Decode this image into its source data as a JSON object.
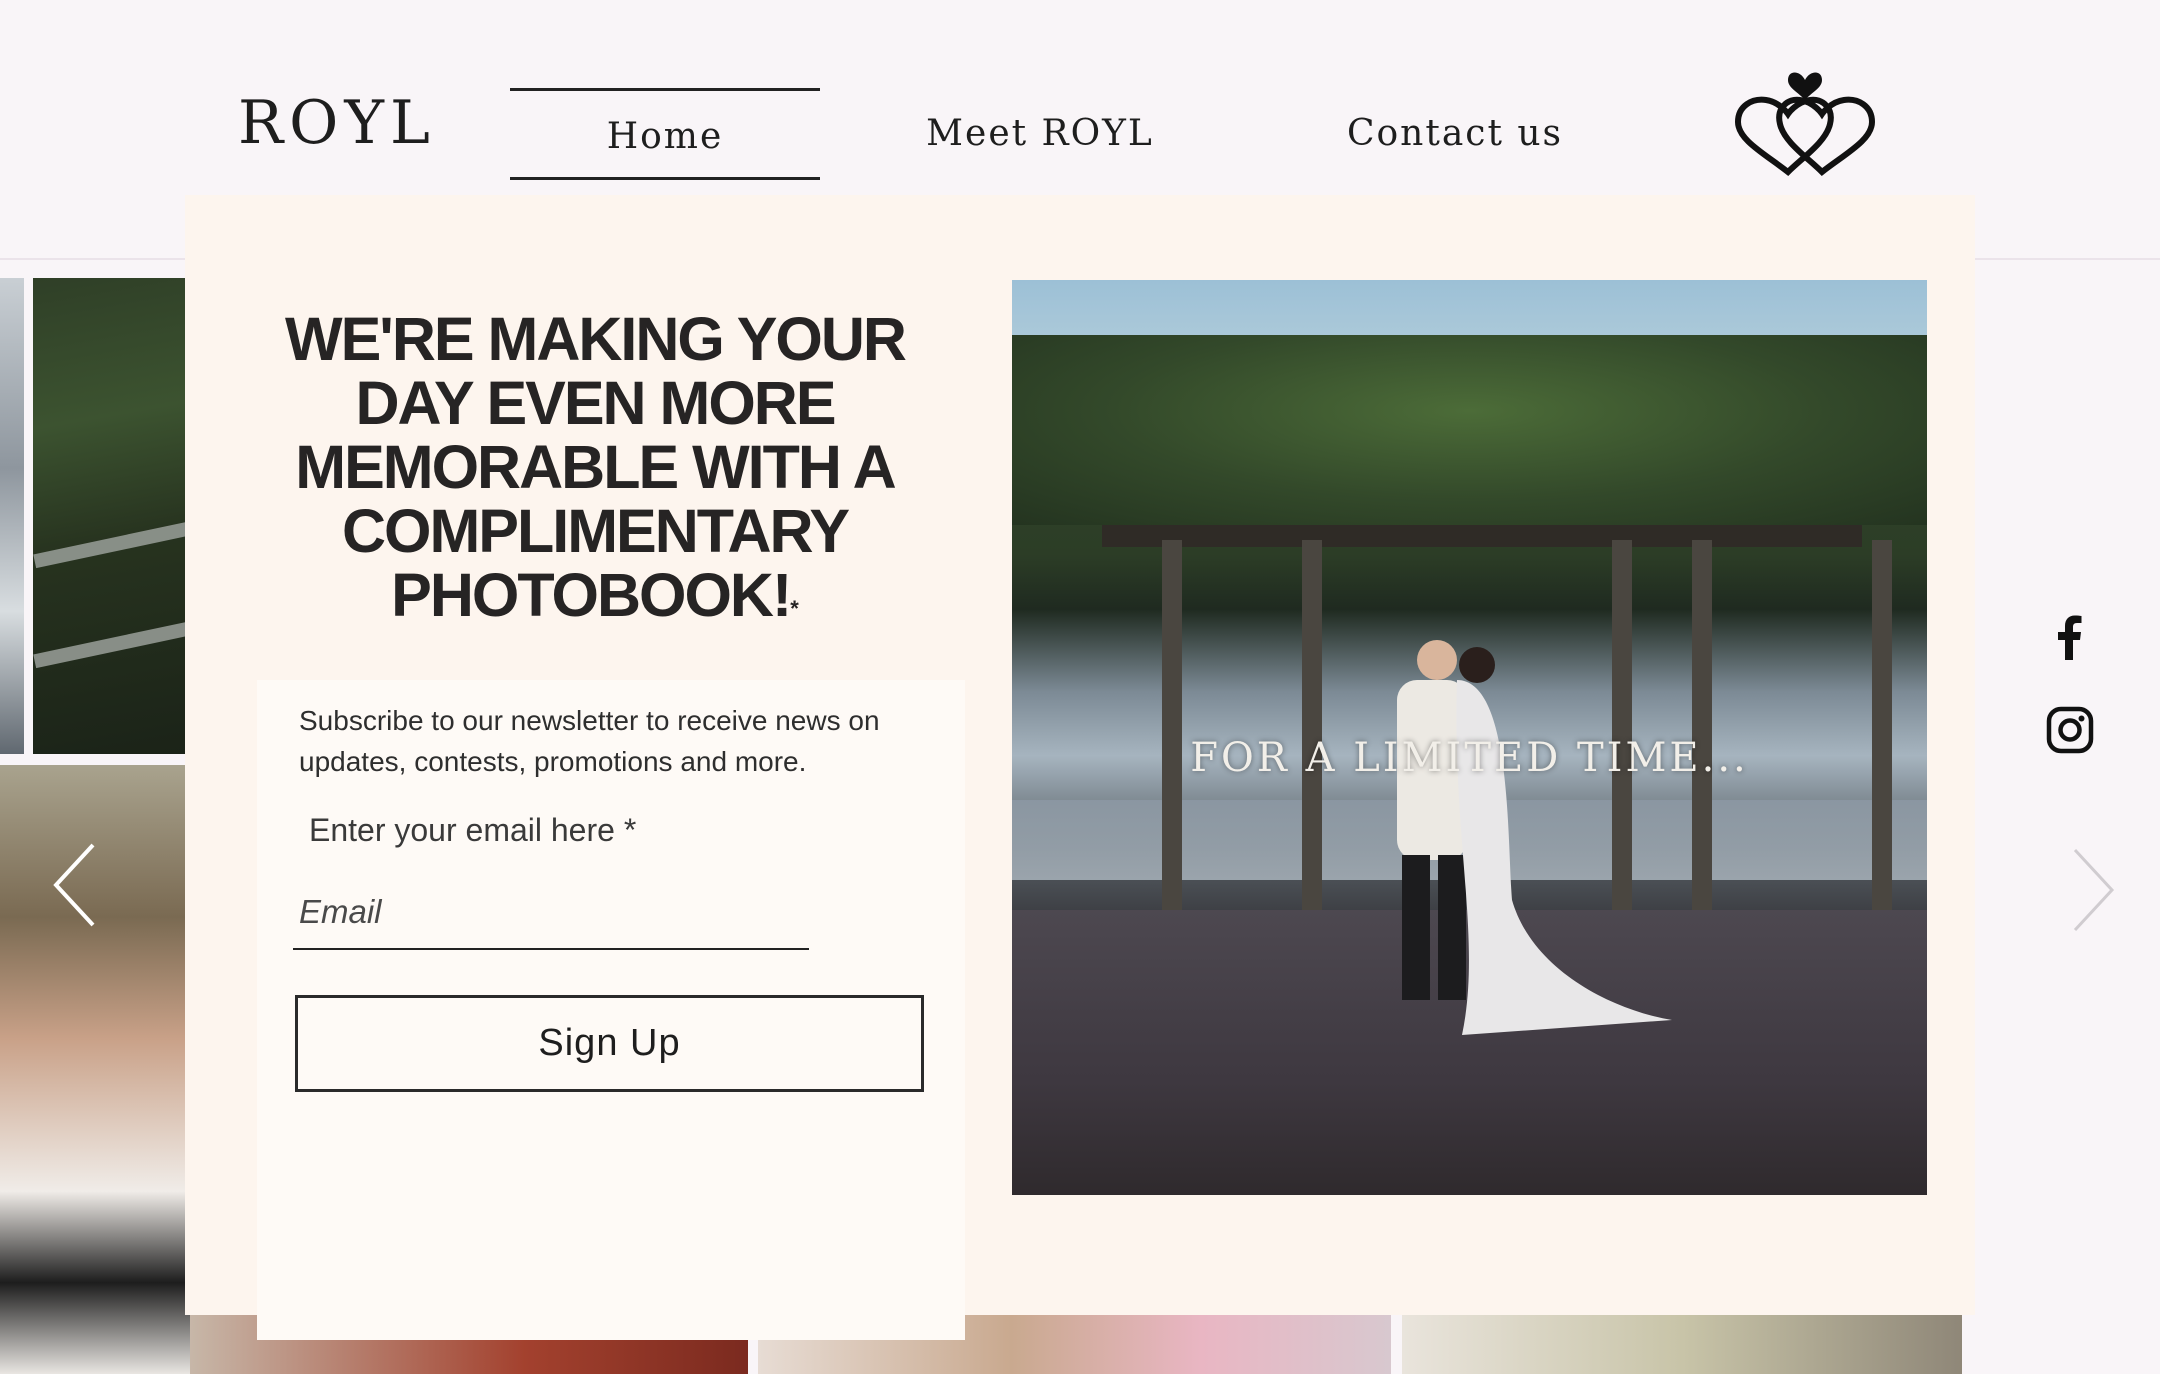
{
  "header": {
    "logo_text": "ROYL",
    "nav": [
      {
        "label": "Home",
        "active": true
      },
      {
        "label": "Meet ROYL",
        "active": false
      },
      {
        "label": "Contact us",
        "active": false
      }
    ],
    "brand_icon": "intertwined-hearts-icon"
  },
  "popup": {
    "headline": "WE'RE MAKING YOUR DAY EVEN MORE MEMORABLE WITH A COMPLIMENTARY PHOTOBOOK!",
    "headline_asterisk": "*",
    "subtitle": "Subscribe to our newsletter to receive news on updates, contests, promotions and more.",
    "email_label": "Enter your email here *",
    "email_placeholder": "Email",
    "email_value": "",
    "button_label": "Sign Up",
    "video_caption": "FOR A LIMITED TIME..."
  },
  "social": {
    "icons": [
      "facebook-icon",
      "instagram-icon"
    ]
  },
  "gallery": {
    "prev_icon": "chevron-left-icon",
    "next_icon": "chevron-right-icon"
  },
  "colors": {
    "page_bg": "#f9f5f8",
    "popup_bg": "#fdf5ee",
    "form_bg": "#fefaf6",
    "text": "#262424"
  }
}
